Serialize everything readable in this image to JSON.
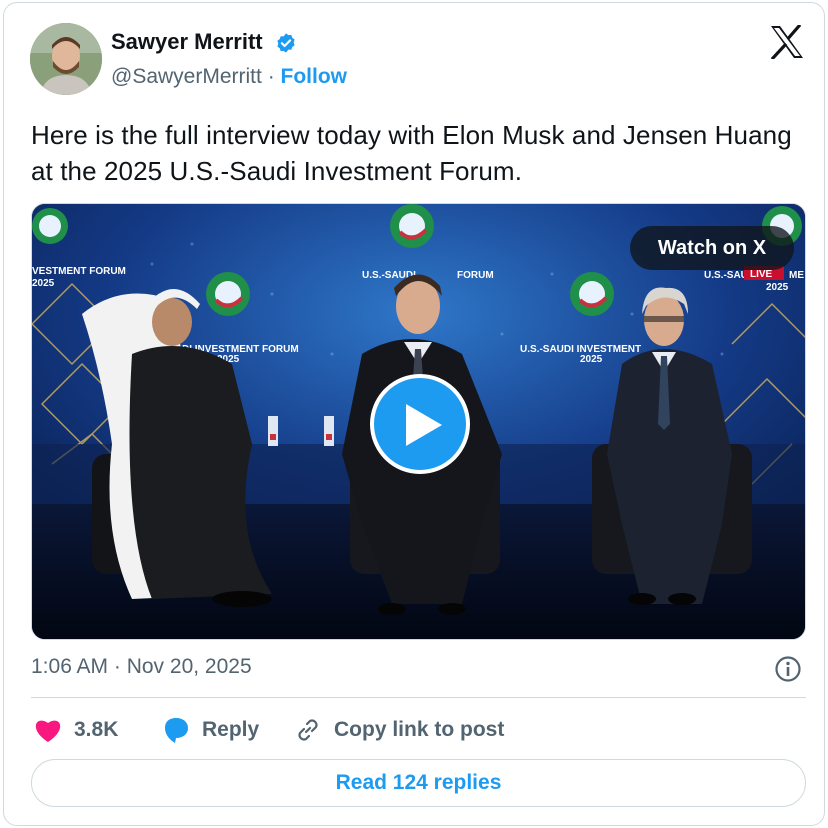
{
  "author": {
    "name": "Sawyer Merritt",
    "handle": "@SawyerMerritt",
    "separator": "·",
    "follow_label": "Follow"
  },
  "tweet": {
    "text": "Here is the full interview today with Elon Musk and Jensen Huang at the 2025 U.S.-Saudi Investment Forum.",
    "timestamp": "1:06 AM · Nov 20, 2025"
  },
  "media": {
    "watch_label": "Watch on X",
    "stage_signage": {
      "left_panel": "VESTMENT FORUM",
      "left_year": "2025",
      "center_left": "DI INVESTMENT FORUM",
      "center_left_year": "2025",
      "center_right": "U.S.-SAUDI INVESTMENT",
      "center_right_year": "2025",
      "top_center": "U.S.-SAUDI",
      "top_center_suffix": "FORUM",
      "right_corner": "U.S.-SAU",
      "right_corner_suffix": "ME",
      "right_year": "2025",
      "live_badge": "LIVE"
    }
  },
  "actions": {
    "likes": "3.8K",
    "reply_label": "Reply",
    "copy_label": "Copy link to post",
    "read_replies_label": "Read 124 replies"
  },
  "colors": {
    "accent": "#1d9bf0",
    "like": "#f91880",
    "muted": "#536471",
    "border": "#cfd9de"
  },
  "icons": [
    "verified-badge-icon",
    "x-logo-icon",
    "play-icon",
    "info-icon",
    "heart-icon",
    "reply-bubble-icon",
    "link-icon"
  ]
}
